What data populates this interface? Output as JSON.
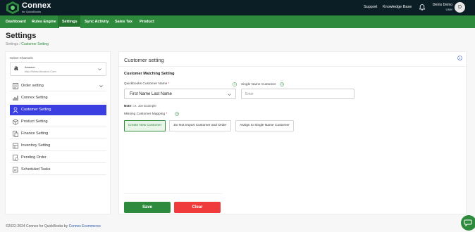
{
  "brand": {
    "name": "Connex",
    "sub": "for QuickBooks"
  },
  "top_links": {
    "support": "Support",
    "knowledge_base": "Knowledge Base"
  },
  "user": {
    "name": "Demo Demo",
    "role": "User",
    "initial": "D"
  },
  "nav": [
    "Dashboard",
    "Rules Engine",
    "Settings",
    "Sync Activity",
    "Sales Tax",
    "Product"
  ],
  "nav_active": "Settings",
  "page": {
    "title": "Settings",
    "crumb_root": "Settings",
    "crumb_sep": "/",
    "crumb_current": "Customer Setting"
  },
  "sidebar": {
    "select_label": "Select Channels",
    "channel": {
      "name": "Amazon",
      "url": "http://Www.Amazon.Com"
    },
    "items": [
      {
        "label": "Order setting",
        "icon": "order-icon"
      },
      {
        "label": "Connex Setting",
        "icon": "bar-chart-icon"
      },
      {
        "label": "Customer Setting",
        "icon": "user-icon"
      },
      {
        "label": "Product Setting",
        "icon": "box-icon"
      },
      {
        "label": "Finance Setting",
        "icon": "finance-icon"
      },
      {
        "label": "Inventory Setting",
        "icon": "inventory-icon"
      },
      {
        "label": "Pending Order",
        "icon": "pending-icon"
      },
      {
        "label": "Scheduled Tasks",
        "icon": "tasks-icon"
      }
    ],
    "active_item": "Customer Setting"
  },
  "main": {
    "title": "Customer setting",
    "section_title": "Customer Matching Setting",
    "qb_label": "Quickbooks Customer Name",
    "qb_required": "*",
    "qb_value": "First Name Last Name",
    "single_label": "Single Name Customer",
    "single_placeholder": "Enter",
    "note_bold": "Note",
    "note_text": ": i.e. Joe Example",
    "missing_label": "Missing Customer Mapping",
    "missing_required": "*",
    "options": [
      "Create New Customer",
      "Do Not Import Customer and Order",
      "Assign to Single Name Customer"
    ],
    "selected_option": "Create New Customer",
    "save": "Save",
    "clear": "Clear"
  },
  "footer": {
    "text": "©2022-2024 Connex for QuickBooks by ",
    "link": "Connex Ecommerce"
  },
  "colors": {
    "primary": "#2e8b3d",
    "topbar": "#0b1e26",
    "active_item": "#3b3ee0",
    "danger": "#ef3b3b"
  }
}
